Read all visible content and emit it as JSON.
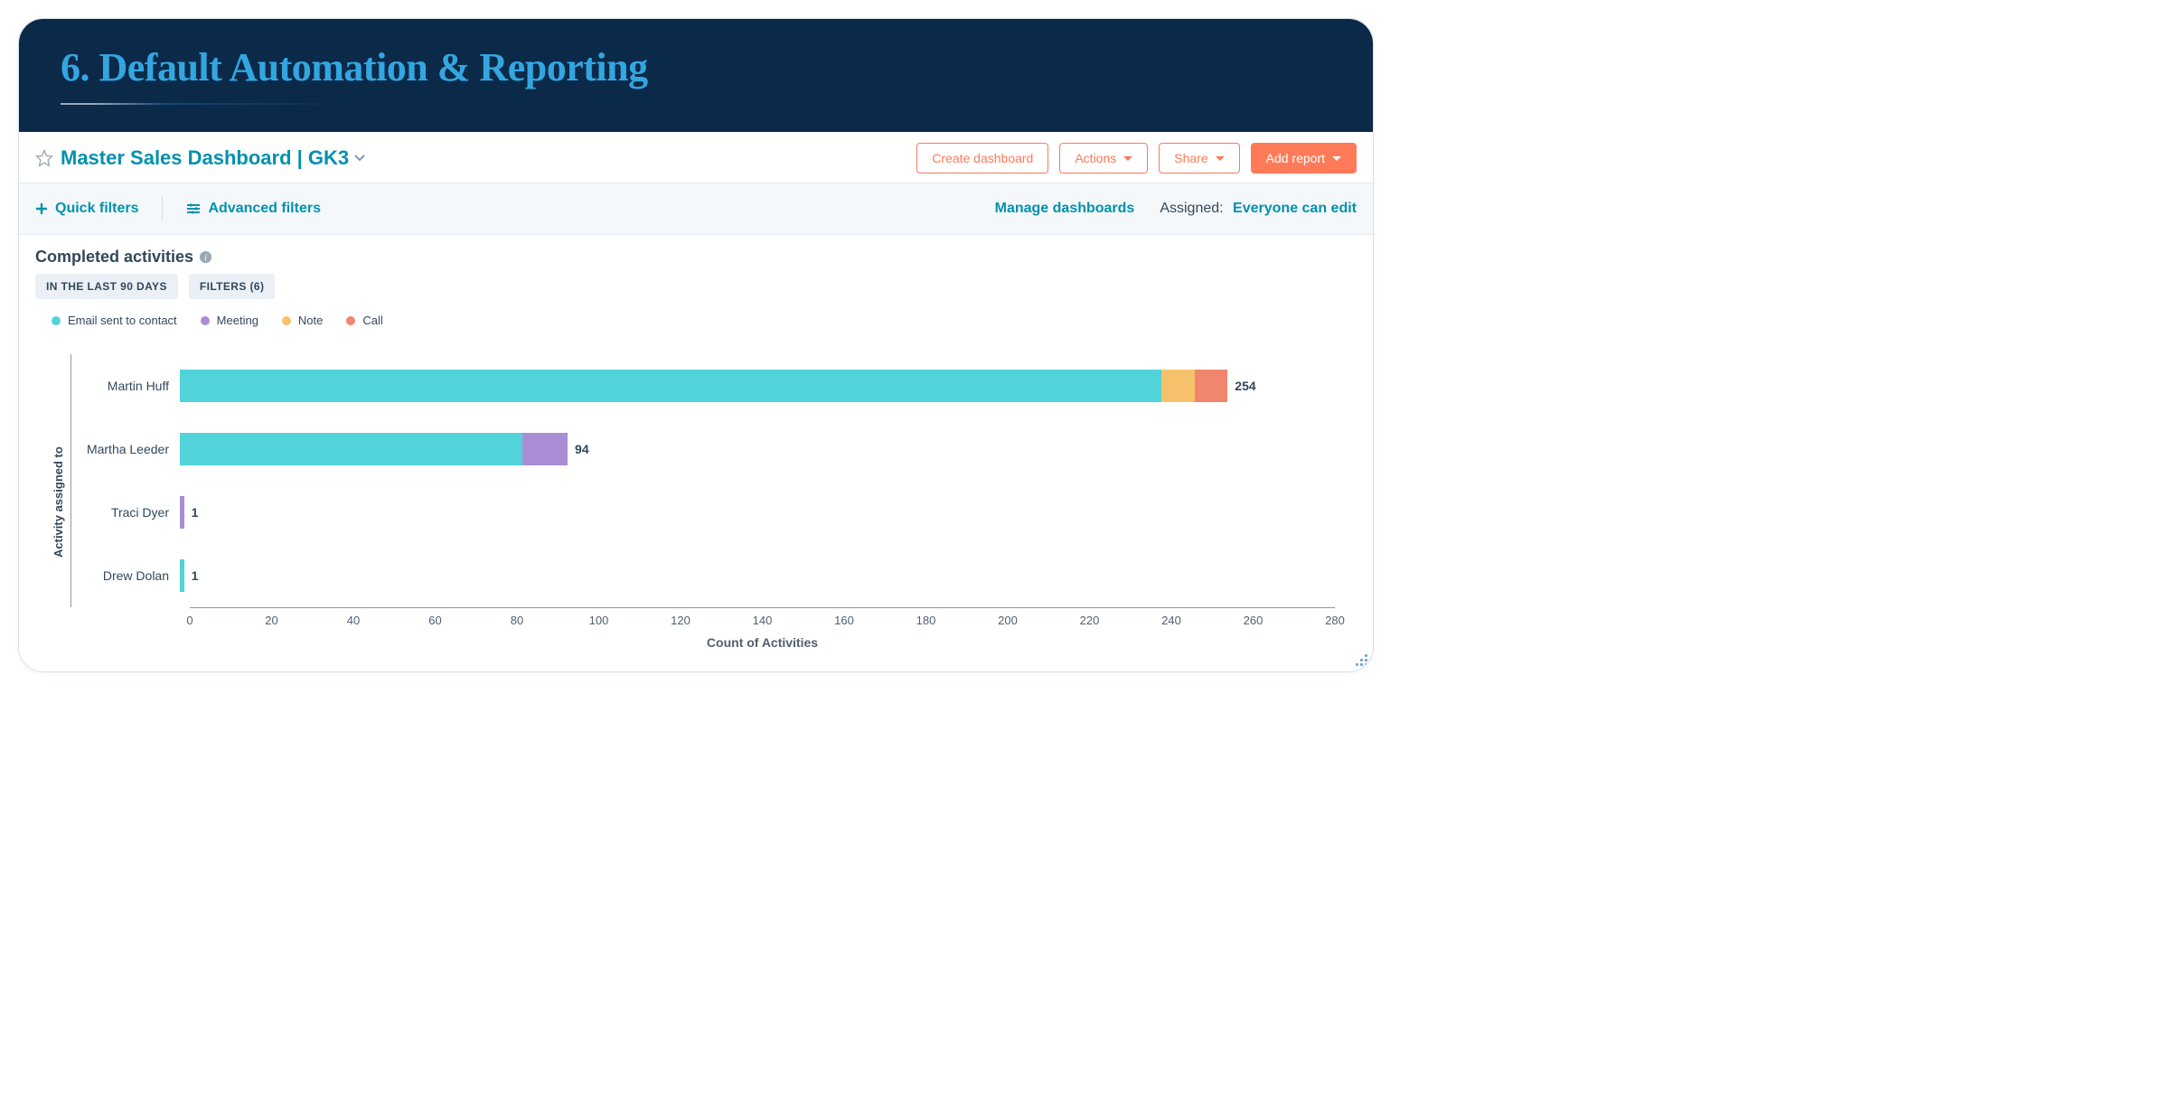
{
  "header": {
    "title": "6. Default Automation & Reporting"
  },
  "dashboard": {
    "title": "Master Sales Dashboard | GK3",
    "create_btn": "Create dashboard",
    "actions_btn": "Actions",
    "share_btn": "Share",
    "add_report_btn": "Add report"
  },
  "filters": {
    "quick": "Quick filters",
    "advanced": "Advanced filters",
    "manage": "Manage dashboards",
    "assigned_label": "Assigned:",
    "assigned_value": "Everyone can edit"
  },
  "card": {
    "title": "Completed activities",
    "chip_range": "IN THE LAST 90 DAYS",
    "chip_filters": "FILTERS (6)"
  },
  "legend": [
    {
      "label": "Email sent to contact",
      "color": "#51d3d9"
    },
    {
      "label": "Meeting",
      "color": "#a98ed6"
    },
    {
      "label": "Note",
      "color": "#f5c26b"
    },
    {
      "label": "Call",
      "color": "#f2856d"
    }
  ],
  "chart_data": {
    "type": "bar",
    "orientation": "horizontal",
    "stacked": true,
    "title": "Completed activities",
    "xlabel": "Count of Activities",
    "ylabel": "Activity assigned to",
    "xlim": [
      0,
      280
    ],
    "xticks": [
      0,
      20,
      40,
      60,
      80,
      100,
      120,
      140,
      160,
      180,
      200,
      220,
      240,
      260,
      280
    ],
    "categories": [
      "Martin Huff",
      "Martha Leeder",
      "Traci Dyer",
      "Drew Dolan"
    ],
    "series": [
      {
        "name": "Email sent to contact",
        "color": "#51d3d9",
        "values": [
          238,
          83,
          0,
          1
        ]
      },
      {
        "name": "Meeting",
        "color": "#a98ed6",
        "values": [
          0,
          11,
          1,
          0
        ]
      },
      {
        "name": "Note",
        "color": "#f5c26b",
        "values": [
          8,
          0,
          0,
          0
        ]
      },
      {
        "name": "Call",
        "color": "#f2856d",
        "values": [
          8,
          0,
          0,
          0
        ]
      }
    ],
    "totals": [
      254,
      94,
      1,
      1
    ]
  }
}
